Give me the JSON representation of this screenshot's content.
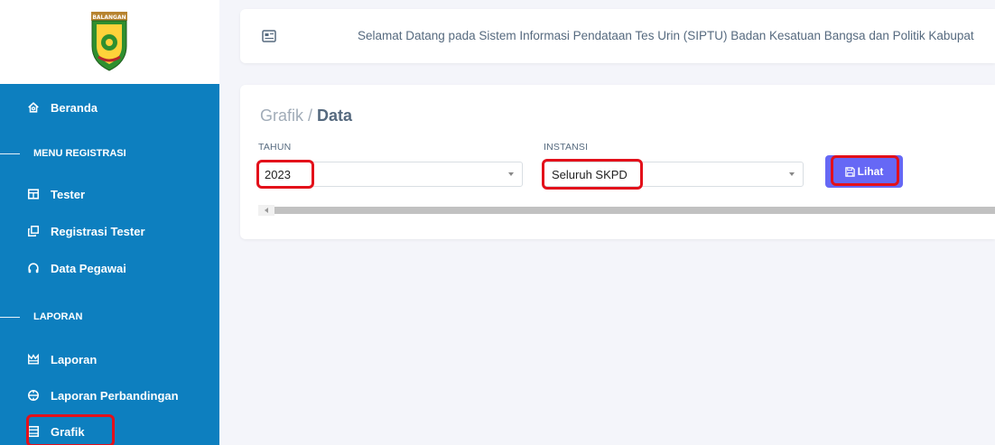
{
  "logo": {
    "icon": "regency-crest-logo",
    "label": "BALANGAN"
  },
  "sidebar": {
    "items": [
      {
        "label": "Beranda",
        "icon": "home-icon"
      },
      {
        "label": "MENU REGISTRASI",
        "type": "header"
      },
      {
        "label": "Tester",
        "icon": "table-icon"
      },
      {
        "label": "Registrasi Tester",
        "icon": "copy-icon"
      },
      {
        "label": "Data Pegawai",
        "icon": "headphones-icon"
      },
      {
        "label": "LAPORAN",
        "type": "header"
      },
      {
        "label": "Laporan",
        "icon": "crown-icon"
      },
      {
        "label": "Laporan Perbandingan",
        "icon": "compare-icon"
      },
      {
        "label": "Grafik",
        "icon": "calendar-icon",
        "active": true
      }
    ]
  },
  "topbar": {
    "welcome": "Selamat Datang pada Sistem Informasi Pendataan Tes Urin (SIPTU) Badan Kesatuan Bangsa dan Politik Kabupat"
  },
  "breadcrumb": {
    "parent": "Grafik",
    "separator": " / ",
    "current": "Data"
  },
  "form": {
    "tahun_label": "TAHUN",
    "tahun_value": "2023",
    "instansi_label": "INSTANSI",
    "instansi_value": "Seluruh SKPD",
    "lihat_label": "Lihat"
  },
  "colors": {
    "sidebar": "#0d7fbf",
    "button": "#6668f5",
    "highlight": "#e3101a",
    "background": "#f4f5fa"
  }
}
